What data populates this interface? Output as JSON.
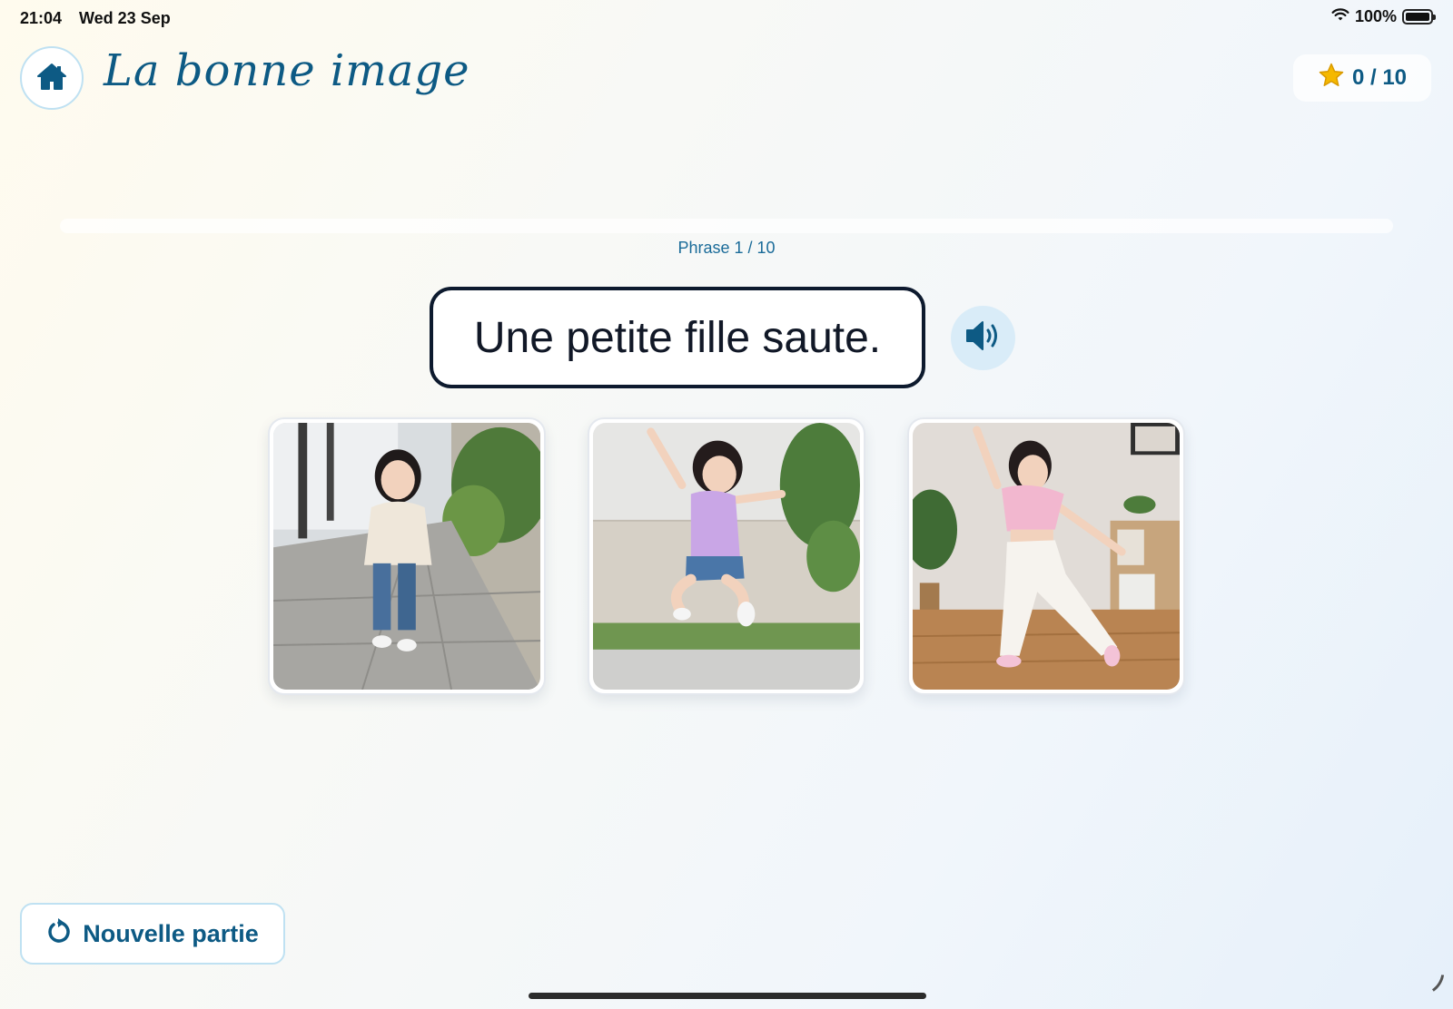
{
  "status_bar": {
    "time": "21:04",
    "date": "Wed 23 Sep",
    "battery": "100%",
    "battery_level": 1.0
  },
  "header": {
    "title": "La bonne image",
    "home_icon": "home-icon",
    "score": {
      "icon": "star-icon",
      "value": "0 / 10"
    }
  },
  "progress": {
    "fraction": 0.0,
    "label": "Phrase 1 / 10"
  },
  "sentence": {
    "text": "Une petite fille saute.",
    "audio_icon": "speaker-icon"
  },
  "cards": [
    {
      "name": "girl-walking-image"
    },
    {
      "name": "girl-jumping-image"
    },
    {
      "name": "girl-dancing-image"
    }
  ],
  "footer": {
    "new_game_label": "Nouvelle partie",
    "new_game_icon": "restart-icon"
  },
  "colors": {
    "accent": "#0d5a84",
    "sentence_border": "#0d1a2e",
    "audio_bg": "#d9ecf8",
    "star": "#f5b800"
  }
}
